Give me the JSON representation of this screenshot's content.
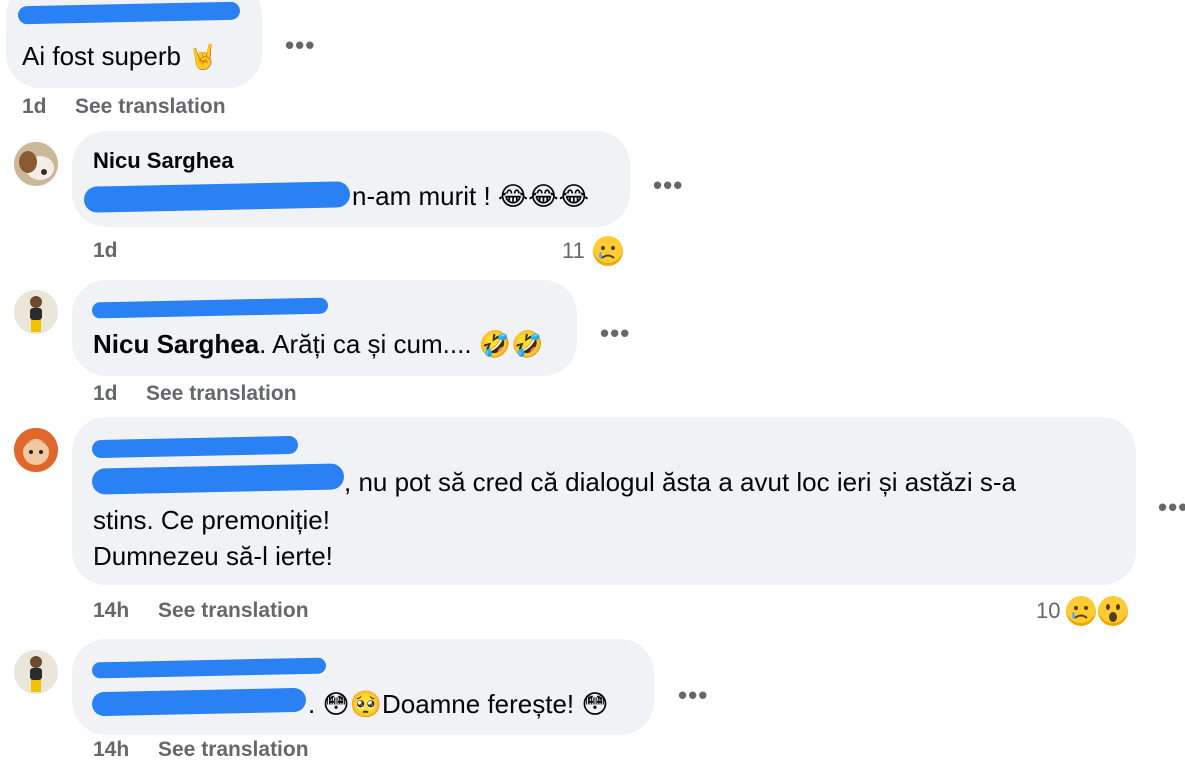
{
  "comments": [
    {
      "name": "",
      "text": "Ai fost superb",
      "text_emoji": "rock-hand",
      "time": "1d",
      "action": "See translation"
    },
    {
      "name": "Nicu Sarghea",
      "text": "n-am murit !",
      "text_emoji": "laughing-face x3",
      "time": "1d",
      "reaction_count": "11",
      "reaction_icon": "sad-face"
    },
    {
      "name": "",
      "mention": "Nicu Sarghea",
      "text": ". Arăți ca și cum....",
      "text_emoji": "rolling-laughing-face x2",
      "time": "1d",
      "action": "See translation"
    },
    {
      "name": "",
      "text_line1": ", nu pot să cred că dialogul ăsta a avut loc ieri și astăzi s-a",
      "text_line2": "stins. Ce premoniție!",
      "text_line3": "Dumnezeu să-l ierte!",
      "time": "14h",
      "action": "See translation",
      "reaction_count": "10",
      "reaction_icons": [
        "sad-face",
        "wow-face"
      ]
    },
    {
      "name": "",
      "text_pre": ".",
      "text": "Doamne ferește!",
      "text_emoji": "flushed-face, pleading-face, flushed-face",
      "time": "14h",
      "action": "See translation"
    }
  ],
  "more_glyph": "•••",
  "colors": {
    "bubble": "#f0f2f5",
    "meta": "#65676b",
    "scribble": "#1877f2"
  }
}
